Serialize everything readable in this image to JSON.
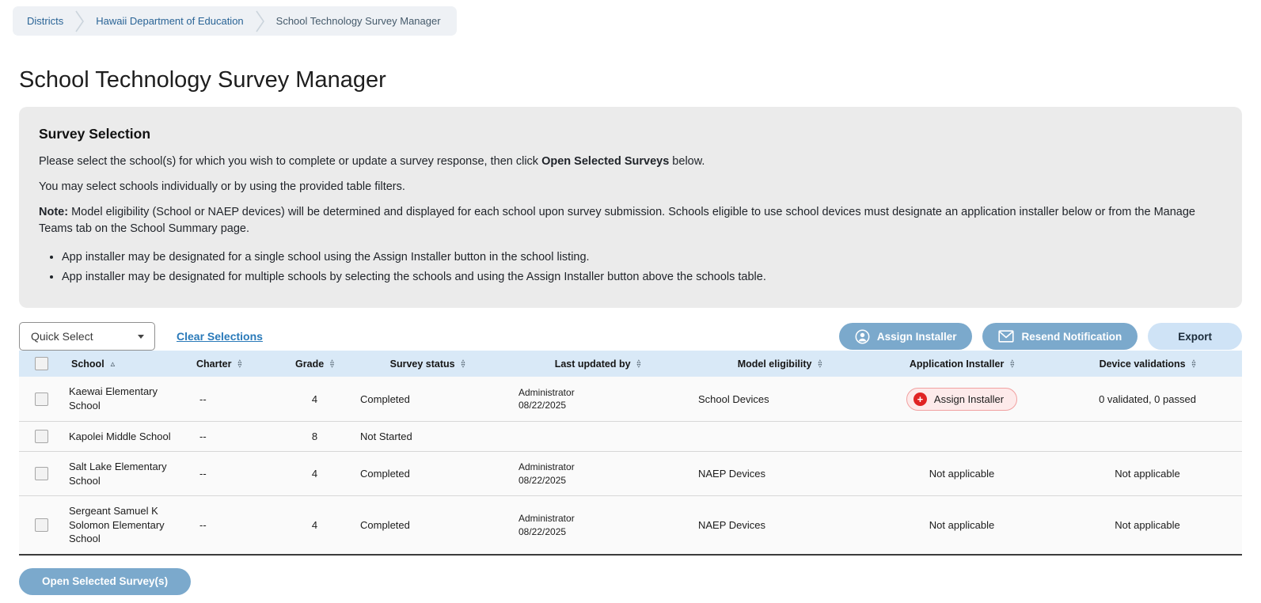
{
  "breadcrumb": {
    "items": [
      "Districts",
      "Hawaii Department of Education",
      "School Technology Survey Manager"
    ]
  },
  "page": {
    "title": "School Technology Survey Manager"
  },
  "panel": {
    "heading": "Survey Selection",
    "p1_before": "Please select the school(s) for which you wish to complete or update a survey response, then click ",
    "p1_bold": "Open Selected Surveys",
    "p1_after": " below.",
    "p2": "You may select schools individually or by using the provided table filters.",
    "note_label": "Note:",
    "note_text": " Model eligibility (School or NAEP devices) will be determined and displayed for each school upon survey submission. Schools eligible to use school devices must designate an application installer below or from the Manage Teams tab on the School Summary page.",
    "bullets": [
      "App installer may be designated for a single school using the Assign Installer button in the school listing.",
      "App installer may be designated for multiple schools by selecting the schools and using the Assign Installer button above the schools table."
    ]
  },
  "toolbar": {
    "quick_select_label": "Quick Select",
    "clear_selections_label": "Clear Selections",
    "assign_installer_label": "Assign Installer",
    "resend_notification_label": "Resend Notification",
    "export_label": "Export"
  },
  "table": {
    "columns": [
      {
        "key": "school",
        "label": "School",
        "sort": "asc",
        "align": "left"
      },
      {
        "key": "charter",
        "label": "Charter",
        "sort": "both",
        "align": "left"
      },
      {
        "key": "grade",
        "label": "Grade",
        "sort": "both",
        "align": "center"
      },
      {
        "key": "status",
        "label": "Survey status",
        "sort": "both",
        "align": "center"
      },
      {
        "key": "updated",
        "label": "Last updated by",
        "sort": "both",
        "align": "center"
      },
      {
        "key": "model",
        "label": "Model eligibility",
        "sort": "both",
        "align": "center"
      },
      {
        "key": "installer",
        "label": "Application Installer",
        "sort": "both",
        "align": "center"
      },
      {
        "key": "validations",
        "label": "Device validations",
        "sort": "both",
        "align": "center"
      }
    ],
    "rows": [
      {
        "school": "Kaewai Elementary School",
        "charter": "--",
        "grade": "4",
        "survey_status": "Completed",
        "last_updated_by": "Administrator",
        "last_updated_date": "08/22/2025",
        "model_eligibility": "School Devices",
        "installer": {
          "type": "button",
          "label": "Assign Installer"
        },
        "device_validations": "0 validated, 0 passed"
      },
      {
        "school": "Kapolei Middle School",
        "charter": "--",
        "grade": "8",
        "survey_status": "Not Started",
        "last_updated_by": "",
        "last_updated_date": "",
        "model_eligibility": "",
        "installer": {
          "type": "none",
          "label": ""
        },
        "device_validations": ""
      },
      {
        "school": "Salt Lake Elementary School",
        "charter": "--",
        "grade": "4",
        "survey_status": "Completed",
        "last_updated_by": "Administrator",
        "last_updated_date": "08/22/2025",
        "model_eligibility": "NAEP Devices",
        "installer": {
          "type": "text",
          "label": "Not applicable"
        },
        "device_validations": "Not applicable"
      },
      {
        "school": "Sergeant Samuel K Solomon Elementary School",
        "charter": "--",
        "grade": "4",
        "survey_status": "Completed",
        "last_updated_by": "Administrator",
        "last_updated_date": "08/22/2025",
        "model_eligibility": "NAEP Devices",
        "installer": {
          "type": "text",
          "label": "Not applicable"
        },
        "device_validations": "Not applicable"
      }
    ]
  },
  "footer": {
    "open_button_label": "Open Selected Survey(s)"
  },
  "colors": {
    "accent": "#7BA9CC",
    "accent_light": "#CFE3F6",
    "header_bg": "#D9E9F7",
    "link": "#2A7AB9",
    "danger": "#E02424",
    "pill_bg": "#FDEAEA",
    "pill_border": "#F1A1A1",
    "panel": "#EBEBEB",
    "crumb_link": "#2A6496"
  }
}
